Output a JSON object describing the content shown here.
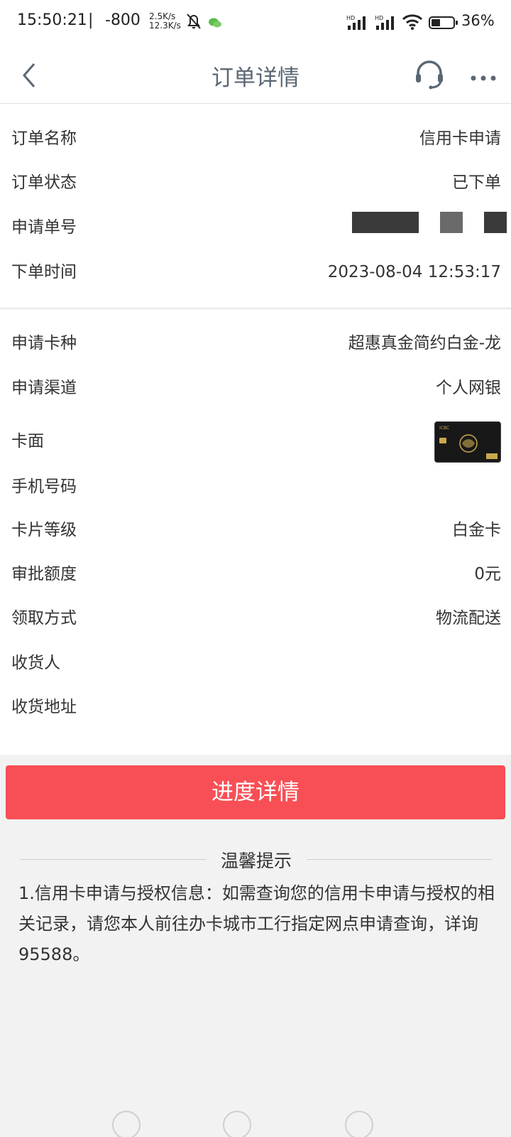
{
  "status_bar": {
    "time": "15:50:21",
    "separator": "|",
    "network_value": "-800",
    "speed_up": "2.5K/s",
    "speed_down": "12.3K/s",
    "battery": "36%",
    "icons": [
      "bell-muted-icon",
      "wechat-icon",
      "signal-hd-icon",
      "signal-hd-icon",
      "wifi-icon",
      "battery-icon"
    ]
  },
  "nav": {
    "title": "订单详情",
    "icons": [
      "back-arrow-icon",
      "customer-service-headset-icon",
      "more-dots-icon"
    ]
  },
  "order_info": [
    {
      "label": "订单名称",
      "value": "信用卡申请"
    },
    {
      "label": "订单状态",
      "value": "已下单"
    },
    {
      "label": "申请单号",
      "value": ""
    },
    {
      "label": "下单时间",
      "value": "2023-08-04 12:53:17"
    }
  ],
  "card_info": [
    {
      "label": "申请卡种",
      "value": "超惠真金简约白金-龙"
    },
    {
      "label": "申请渠道",
      "value": "个人网银"
    },
    {
      "label": "卡面",
      "value": ""
    },
    {
      "label": "手机号码",
      "value": ""
    },
    {
      "label": "卡片等级",
      "value": "白金卡"
    },
    {
      "label": "审批额度",
      "value": "0元"
    },
    {
      "label": "领取方式",
      "value": "物流配送"
    },
    {
      "label": "收货人",
      "value": ""
    },
    {
      "label": "收货地址",
      "value": ""
    }
  ],
  "progress_button": "进度详情",
  "tips": {
    "title": "温馨提示",
    "body": "1.信用卡申请与授权信息：如需查询您的信用卡申请与授权的相关记录，请您本人前往办卡城市工行指定网点申请查询，详询95588。"
  },
  "colors": {
    "accent_red": "#f74f55",
    "nav_title": "#5a6773",
    "background": "#f2f2f2"
  }
}
